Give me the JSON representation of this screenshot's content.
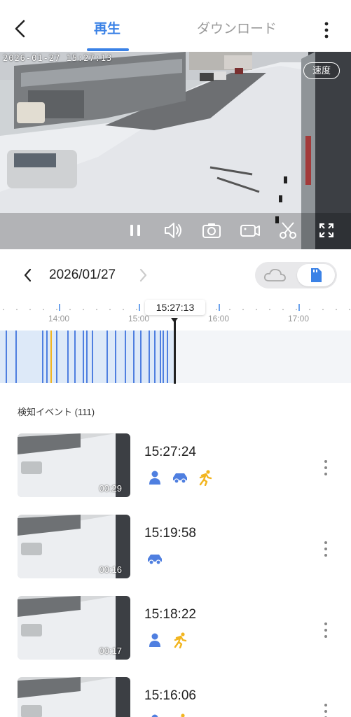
{
  "header": {
    "tabs": [
      {
        "label": "再生",
        "active": true
      },
      {
        "label": "ダウンロード",
        "active": false
      }
    ],
    "accent_color": "#3b82e6"
  },
  "player": {
    "osd_timestamp": "2026-01-27  15:27:13",
    "speed_label": "速度",
    "controls": [
      "pause-icon",
      "volume-icon",
      "camera-icon",
      "record-icon",
      "scissors-icon",
      "fullscreen-icon"
    ]
  },
  "date_nav": {
    "date": "2026/01/27",
    "storage_options": [
      "cloud-icon",
      "sd-card-icon"
    ],
    "selected_storage": "sd-card-icon"
  },
  "timeline": {
    "current_time": "15:27:13",
    "hour_labels": [
      "14:00",
      "15:00",
      "16:00",
      "17:00"
    ]
  },
  "events": {
    "title": "検知イベント (111)",
    "items": [
      {
        "time": "15:27:24",
        "duration": "00:29",
        "types": [
          "person",
          "vehicle",
          "motion"
        ]
      },
      {
        "time": "15:19:58",
        "duration": "00:16",
        "types": [
          "vehicle"
        ]
      },
      {
        "time": "15:18:22",
        "duration": "00:17",
        "types": [
          "person",
          "motion"
        ]
      },
      {
        "time": "15:16:06",
        "duration": "",
        "types": [
          "person",
          "motion"
        ]
      }
    ]
  }
}
